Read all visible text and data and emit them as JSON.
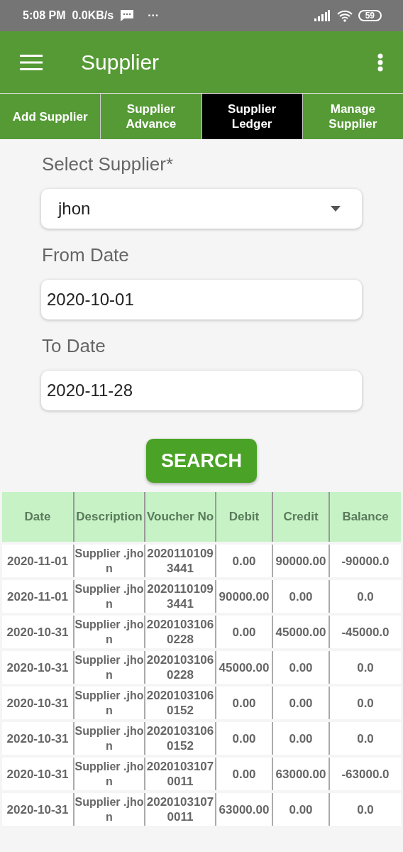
{
  "status_bar": {
    "time": "5:08 PM",
    "speed": "0.0KB/s",
    "more": "···",
    "battery": "59"
  },
  "app_bar": {
    "title": "Supplier"
  },
  "tabs": [
    {
      "label": "Add Supplier",
      "selected": false
    },
    {
      "label": "Supplier Advance",
      "selected": false
    },
    {
      "label": "Supplier Ledger",
      "selected": true
    },
    {
      "label": "Manage Supplier",
      "selected": false
    }
  ],
  "form": {
    "fields": [
      {
        "kind": "dropdown",
        "label": "Select Supplier*",
        "value": "jhon"
      },
      {
        "kind": "text",
        "label": "From Date",
        "value": "2020-10-01"
      },
      {
        "kind": "text",
        "label": "To Date",
        "value": "2020-11-28"
      }
    ],
    "button": "SEARCH"
  },
  "table": {
    "columns": [
      "Date",
      "Description",
      "Voucher No",
      "Debit",
      "Credit",
      "Balance"
    ],
    "rows": [
      [
        "2020-11-01",
        "Supplier .jhon",
        "20201101093441",
        "0.00",
        "90000.00",
        "-90000.0"
      ],
      [
        "2020-11-01",
        "Supplier .jhon",
        "20201101093441",
        "90000.00",
        "0.00",
        "0.0"
      ],
      [
        "2020-10-31",
        "Supplier .jhon",
        "20201031060228",
        "0.00",
        "45000.00",
        "-45000.0"
      ],
      [
        "2020-10-31",
        "Supplier .jhon",
        "20201031060228",
        "45000.00",
        "0.00",
        "0.0"
      ],
      [
        "2020-10-31",
        "Supplier .jhon",
        "20201031060152",
        "0.00",
        "0.00",
        "0.0"
      ],
      [
        "2020-10-31",
        "Supplier .jhon",
        "20201031060152",
        "0.00",
        "0.00",
        "0.0"
      ],
      [
        "2020-10-31",
        "Supplier .jhon",
        "20201031070011",
        "0.00",
        "63000.00",
        "-63000.0"
      ],
      [
        "2020-10-31",
        "Supplier .jhon",
        "20201031070011",
        "63000.00",
        "0.00",
        "0.0"
      ]
    ]
  }
}
